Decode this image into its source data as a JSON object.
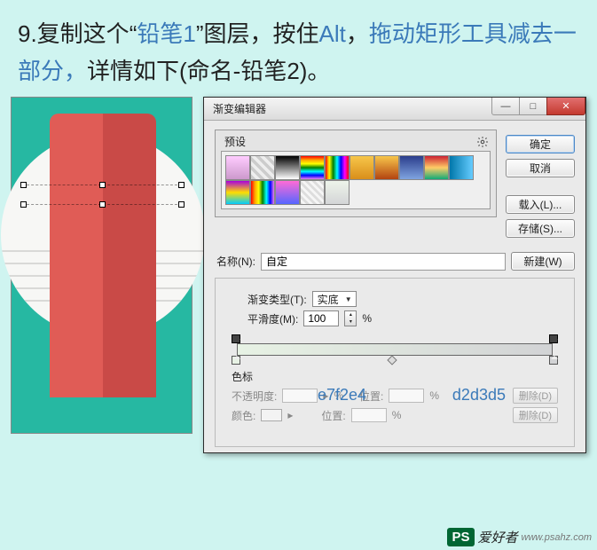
{
  "instruction": {
    "step": "9.",
    "t1": "复制这个",
    "quote_open": "“",
    "layer": "铅笔1",
    "quote_close": "”",
    "t2": "图层，按住",
    "alt": "Alt",
    "t3": "，拖动矩形工具减去一部分，详情如下(命名-铅笔2)。"
  },
  "dialog": {
    "title": "渐变编辑器",
    "preset_label": "预设",
    "buttons": {
      "ok": "确定",
      "cancel": "取消",
      "load": "载入(L)...",
      "save": "存储(S)...",
      "new": "新建(W)"
    },
    "name_label": "名称(N):",
    "name_value": "自定",
    "grad_type_label": "渐变类型(T):",
    "grad_type_value": "实底",
    "smooth_label": "平滑度(M):",
    "smooth_value": "100",
    "percent": "%",
    "section_label": "色标",
    "row1": {
      "label": "不透明度:",
      "unit": "%",
      "pos": "位置:",
      "del": "删除(D)"
    },
    "row2": {
      "label": "颜色:",
      "pos": "位置:",
      "del": "删除(D)"
    },
    "annot1": "e7f2e4",
    "annot2": "d2d3d5"
  },
  "watermark": {
    "ps": "PS",
    "t1": "爱好者",
    "t2": "www.psahz.com"
  }
}
